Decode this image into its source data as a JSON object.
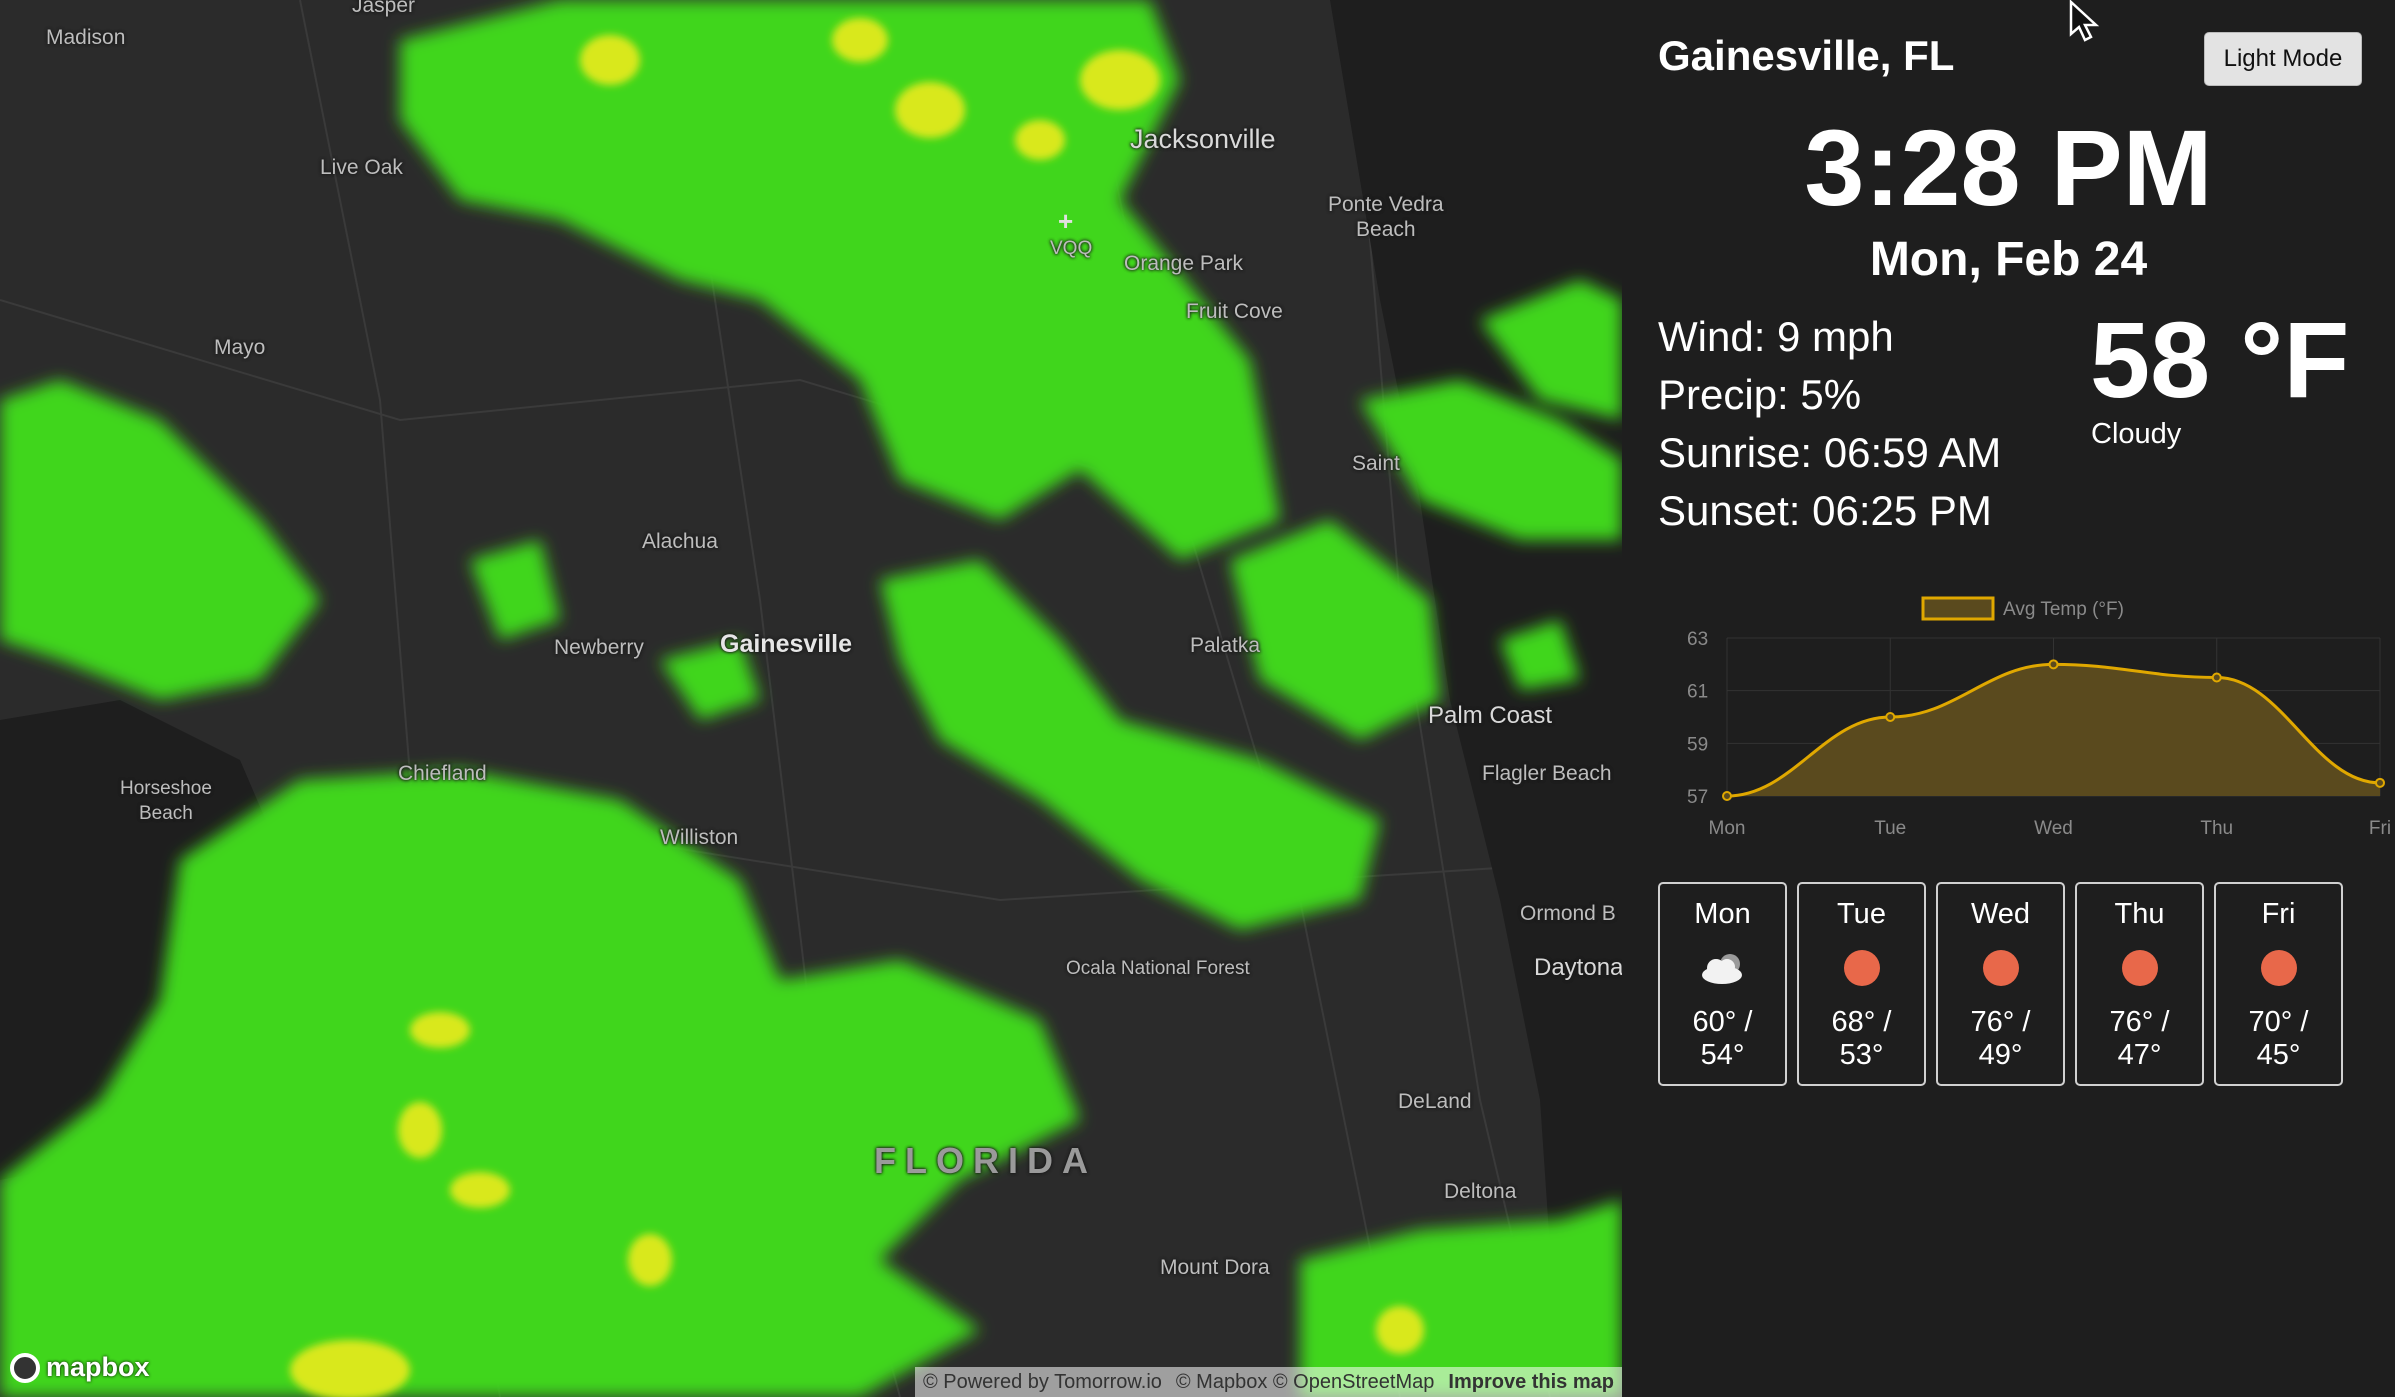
{
  "map": {
    "labels": {
      "madison": "Madison",
      "jasper": "Jasper",
      "jacksonville": "Jacksonville",
      "live_oak": "Live Oak",
      "vqq": "VQQ",
      "orange_park": "Orange Park",
      "ponte_vedra": "Ponte Vedra\nBeach",
      "fruit_cove": "Fruit Cove",
      "mayo": "Mayo",
      "alachua": "Alachua",
      "newberry": "Newberry",
      "gainesville": "Gainesville",
      "palatka": "Palatka",
      "palm_coast": "Palm Coast",
      "flagler_beach": "Flagler Beach",
      "horseshoe_beach": "Horseshoe\nBeach",
      "chiefland": "Chiefland",
      "williston": "Williston",
      "ormond_beach": "Ormond B",
      "daytona": "Daytona",
      "ocala_forest": "Ocala National Forest",
      "deland": "DeLand",
      "florida": "FLORIDA",
      "deltona": "Deltona",
      "mount_dora": "Mount Dora",
      "saint": "Saint"
    },
    "logo_text": "mapbox",
    "attribution": {
      "powered": "© Powered by Tomorrow.io",
      "credits": "© Mapbox © OpenStreetMap",
      "improve": "Improve this map"
    },
    "radar_colors": {
      "light": "#3fd61a",
      "heavy": "#d9e81a",
      "dark": "#1d1d1d"
    }
  },
  "sidebar": {
    "location": "Gainesville, FL",
    "mode_button": "Light Mode",
    "time": "3:28 PM",
    "date": "Mon, Feb 24",
    "wind": "Wind: 9 mph",
    "precip": "Precip: 5%",
    "sunrise": "Sunrise: 06:59 AM",
    "sunset": "Sunset: 06:25 PM",
    "temperature": "58 °F",
    "condition": "Cloudy"
  },
  "chart_data": {
    "type": "area",
    "title": "",
    "legend": [
      "Avg Temp (°F)"
    ],
    "categories": [
      "Mon",
      "Tue",
      "Wed",
      "Thu",
      "Fri"
    ],
    "series": [
      {
        "name": "Avg Temp (°F)",
        "values": [
          57,
          60,
          62,
          61.5,
          57.5
        ]
      }
    ],
    "ylim": [
      57,
      63
    ],
    "yticks": [
      57,
      59,
      61,
      63
    ],
    "grid": true,
    "legend_position": "top",
    "line_color": "#e0a800",
    "fill_color": "#5a4a1e"
  },
  "forecast": [
    {
      "day": "Mon",
      "icon": "cloud-icon",
      "high": "60° /",
      "low": "54°"
    },
    {
      "day": "Tue",
      "icon": "sun-icon",
      "high": "68° /",
      "low": "53°"
    },
    {
      "day": "Wed",
      "icon": "sun-icon",
      "high": "76° /",
      "low": "49°"
    },
    {
      "day": "Thu",
      "icon": "sun-icon",
      "high": "76° /",
      "low": "47°"
    },
    {
      "day": "Fri",
      "icon": "sun-icon",
      "high": "70° /",
      "low": "45°"
    }
  ]
}
